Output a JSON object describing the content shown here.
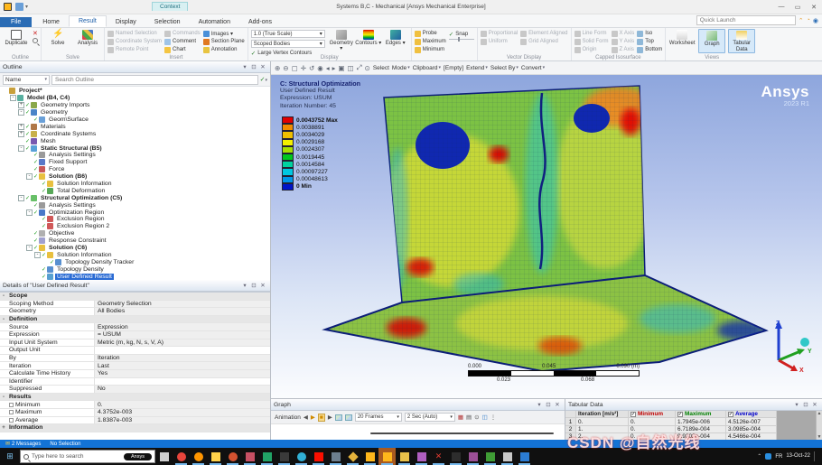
{
  "title_bar": {
    "title": "Systems B,C - Mechanical [Ansys Mechanical Enterprise]"
  },
  "icon_glyphs": {
    "dropdown": "▾",
    "undock": "⊡",
    "close": "✕",
    "minimize": "—",
    "restore": "▭",
    "expander_open": "-",
    "expander_closed": "+",
    "check": "✓"
  },
  "ribbon": {
    "context_label": "Context",
    "tabs": [
      "File",
      "Home",
      "Result",
      "Display",
      "Selection",
      "Automation",
      "Add-ons"
    ],
    "active_tab": "Result",
    "quick_launch_placeholder": "Quick Launch",
    "groups": {
      "outline": {
        "label": "Outline",
        "duplicate": "Duplicate"
      },
      "solve": {
        "label": "Solve",
        "solve": "Solve",
        "analysis": "Analysis"
      },
      "insert": {
        "label": "Insert",
        "cols": [
          [
            {
              "t": "Named Selection",
              "d": 1
            },
            {
              "t": "Coordinate System",
              "d": 1
            },
            {
              "t": "Remote Point",
              "d": 1
            }
          ],
          [
            {
              "t": "Commands",
              "d": 1
            },
            {
              "t": "Comment"
            },
            {
              "t": "Chart"
            }
          ],
          [
            {
              "t": "Images",
              "arrow": 1
            },
            {
              "t": "Section Plane"
            },
            {
              "t": "Annotation"
            }
          ]
        ]
      },
      "display": {
        "label": "Display",
        "scale": "1.0 (True Scale)",
        "bodies": "Scoped Bodies",
        "contours_check": "Large Vertex Contours",
        "big": [
          "Geometry",
          "Contours",
          "Edges"
        ]
      },
      "result_display": {
        "items": [
          "Probe",
          "Maximum",
          "Minimum"
        ],
        "snap": "Snap"
      },
      "vector": {
        "label": "Vector Display",
        "col1": [
          {
            "t": "Proportional",
            "d": 1
          },
          {
            "t": "Uniform",
            "d": 1
          }
        ],
        "col2": [
          {
            "t": "Element Aligned",
            "d": 1
          },
          {
            "t": "Grid Aligned",
            "d": 1
          }
        ]
      },
      "capped": {
        "label": "Capped Isosurface",
        "col1": [
          {
            "t": "Line Form",
            "d": 1
          },
          {
            "t": "Solid Form",
            "d": 1
          },
          {
            "t": "Origin",
            "d": 1
          }
        ],
        "col2": [
          {
            "t": "X Axis",
            "d": 1
          },
          {
            "t": "Y Axis",
            "d": 1
          },
          {
            "t": "Z Axis",
            "d": 1
          }
        ],
        "col3": [
          {
            "t": "Iso"
          },
          {
            "t": "Top"
          },
          {
            "t": "Bottom"
          }
        ]
      },
      "views": {
        "label": "Views",
        "items": [
          {
            "t": "Worksheet"
          },
          {
            "t": "Graph",
            "sel": 1
          },
          {
            "t": "Tabular Data",
            "sel": 1
          }
        ]
      }
    }
  },
  "graphics_toolbar": {
    "icons": [
      "zoom-in-icon",
      "zoom-out-icon",
      "box-zoom-icon",
      "pan-icon",
      "rotate-icon",
      "look-at-icon",
      "previous-view-icon",
      "next-view-icon",
      "fit-icon",
      "wireframe-icon",
      "zoom-fit-icon",
      "magnifier-icon"
    ],
    "buttons": [
      {
        "label": "Select",
        "arrow": 0
      },
      {
        "label": "Mode",
        "arrow": 1
      },
      {
        "label": "Clipboard",
        "arrow": 1
      },
      {
        "label": "[Empty]",
        "arrow": 0
      },
      {
        "label": "Extend",
        "arrow": 1
      },
      {
        "label": "Select By",
        "arrow": 1
      },
      {
        "label": "Convert",
        "arrow": 1
      }
    ]
  },
  "outline": {
    "header": "Outline",
    "filter_label": "Name",
    "search_placeholder": "Search Outline",
    "tree": [
      {
        "l": 0,
        "label": "Project*",
        "icon": "project",
        "bold": 1
      },
      {
        "l": 1,
        "label": "Model (B4, C4)",
        "icon": "model",
        "bold": 1,
        "exp": "-"
      },
      {
        "l": 2,
        "label": "Geometry Imports",
        "icon": "geometry-imports",
        "exp": "+",
        "ck": 1
      },
      {
        "l": 2,
        "label": "Geometry",
        "icon": "geometry",
        "exp": "-",
        "ck": 1
      },
      {
        "l": 3,
        "label": "Geom\\Surface",
        "icon": "surface",
        "ck": 1
      },
      {
        "l": 2,
        "label": "Materials",
        "icon": "materials",
        "exp": "+",
        "ck": 1
      },
      {
        "l": 2,
        "label": "Coordinate Systems",
        "icon": "coordinate-systems",
        "exp": "+",
        "ck": 1
      },
      {
        "l": 2,
        "label": "Mesh",
        "icon": "mesh",
        "ck": 1
      },
      {
        "l": 2,
        "label": "Static Structural (B5)",
        "icon": "static-structural",
        "bold": 1,
        "exp": "-",
        "ck": 1
      },
      {
        "l": 3,
        "label": "Analysis Settings",
        "icon": "analysis-settings",
        "ck": 1
      },
      {
        "l": 3,
        "label": "Fixed Support",
        "icon": "fixed-support",
        "ck": 1
      },
      {
        "l": 3,
        "label": "Force",
        "icon": "force",
        "ck": 1
      },
      {
        "l": 3,
        "label": "Solution (B6)",
        "icon": "solution",
        "bold": 1,
        "exp": "-",
        "ck": 1
      },
      {
        "l": 4,
        "label": "Solution Information",
        "icon": "solution-information",
        "ck": 1
      },
      {
        "l": 4,
        "label": "Total Deformation",
        "icon": "result",
        "ck": 1
      },
      {
        "l": 2,
        "label": "Structural Optimization (C5)",
        "icon": "structural-optimization",
        "bold": 1,
        "exp": "-",
        "ck": 1
      },
      {
        "l": 3,
        "label": "Analysis Settings",
        "icon": "analysis-settings",
        "ck": 1
      },
      {
        "l": 3,
        "label": "Optimization Region",
        "icon": "optimization-region",
        "exp": "-",
        "ck": 1
      },
      {
        "l": 4,
        "label": "Exclusion Region",
        "icon": "exclusion-region",
        "ck": 1
      },
      {
        "l": 4,
        "label": "Exclusion Region 2",
        "icon": "exclusion-region",
        "ck": 1
      },
      {
        "l": 3,
        "label": "Objective",
        "icon": "objective",
        "ck": 1
      },
      {
        "l": 3,
        "label": "Response Constraint",
        "icon": "response-constraint",
        "ck": 1
      },
      {
        "l": 3,
        "label": "Solution (C6)",
        "icon": "solution",
        "bold": 1,
        "exp": "-",
        "ck": 1
      },
      {
        "l": 4,
        "label": "Solution Information",
        "icon": "solution-information",
        "exp": "-",
        "ck": 1
      },
      {
        "l": 5,
        "label": "Topology Density Tracker",
        "icon": "tracker",
        "ck": 1
      },
      {
        "l": 4,
        "label": "Topology Density",
        "icon": "topology-density",
        "ck": 1
      },
      {
        "l": 4,
        "label": "User Defined Result",
        "icon": "user-defined-result",
        "sel": 1,
        "ck": 1
      }
    ]
  },
  "details": {
    "header": "Details of \"User Defined Result\"",
    "sections": [
      {
        "name": "Scope",
        "exp": "-",
        "rows": [
          {
            "k": "Scoping Method",
            "v": "Geometry Selection"
          },
          {
            "k": "Geometry",
            "v": "All Bodies"
          }
        ]
      },
      {
        "name": "Definition",
        "exp": "-",
        "rows": [
          {
            "k": "Source",
            "v": "Expression"
          },
          {
            "k": "Expression",
            "v": "= USUM"
          },
          {
            "k": "Input Unit System",
            "v": "Metric (m, kg, N, s, V, A)"
          },
          {
            "k": "Output Unit",
            "v": ""
          },
          {
            "k": "By",
            "v": "Iteration"
          },
          {
            "k": "Iteration",
            "v": "Last"
          },
          {
            "k": "Calculate Time History",
            "v": "Yes"
          },
          {
            "k": "Identifier",
            "v": ""
          },
          {
            "k": "Suppressed",
            "v": "No"
          }
        ]
      },
      {
        "name": "Results",
        "exp": "-",
        "rows": [
          {
            "k": "Minimum",
            "v": "0.",
            "cb": 1
          },
          {
            "k": "Maximum",
            "v": "4.3752e-003",
            "cb": 1
          },
          {
            "k": "Average",
            "v": "1.8387e-003",
            "cb": 1
          }
        ]
      },
      {
        "name": "Information",
        "exp": "+",
        "rows": []
      }
    ]
  },
  "viewport": {
    "annotation": {
      "line1": "C: Structural Optimization",
      "line2": "User Defined Result",
      "line3": "Expression: USUM",
      "line4": "Iteration Number: 45"
    },
    "legend": {
      "values": [
        "0.0043752 Max",
        "0.0038891",
        "0.0034029",
        "0.0029168",
        "0.0024307",
        "0.0019445",
        "0.0014584",
        "0.00097227",
        "0.00048613",
        "0 Min"
      ],
      "colors": [
        "#e00000",
        "#f08c00",
        "#f0c000",
        "#f4f000",
        "#a8e000",
        "#00c81e",
        "#00d2a0",
        "#00c8e0",
        "#0096e8",
        "#0014c8"
      ]
    },
    "logo": {
      "name": "Ansys",
      "version": "2023 R1"
    },
    "ruler": {
      "t0": "0.000",
      "t1": "0.045",
      "t2": "0.090 (m)",
      "b0": "0.023",
      "b1": "0.068"
    },
    "triad": {
      "x": "X",
      "y": "Y",
      "z": "Z",
      "x_color": "#d02020",
      "y_color": "#20a020",
      "z_color": "#2040d0"
    }
  },
  "graph": {
    "header": "Graph",
    "animation_label": "Animation",
    "frames": "20 Frames",
    "duration": "2 Sec (Auto)"
  },
  "tabular": {
    "header": "Tabular Data",
    "columns": {
      "iteration": "Iteration [m/s²]",
      "min": "Minimum",
      "max": "Maximum",
      "avg": "Average"
    },
    "rows": [
      {
        "n": "1",
        "iter": "0.",
        "min": "0.",
        "max": "1.7945e-006",
        "avg": "4.5126e-007"
      },
      {
        "n": "2",
        "iter": "1.",
        "min": "0.",
        "max": "6.7189e-004",
        "avg": "3.0985e-004"
      },
      {
        "n": "3",
        "iter": "2.",
        "min": "0.",
        "max": "9.9202e-004",
        "avg": "4.5466e-004"
      }
    ]
  },
  "status_bar": {
    "messages": "2 Messages",
    "selection": "No Selection"
  },
  "watermark": {
    "text": "CSDN @自然光线"
  },
  "taskbar": {
    "search_placeholder": "Type here to search",
    "search_button": "Ansys",
    "icons": [
      {
        "name": "task-view-icon",
        "color": "#cfcfcf",
        "shape": "square",
        "run": 0
      },
      {
        "name": "chrome-icon",
        "color": "#e8453c",
        "shape": "circle",
        "run": 1
      },
      {
        "name": "firefox-icon",
        "color": "#ff9500",
        "shape": "circle",
        "run": 1
      },
      {
        "name": "file-explorer-icon",
        "color": "#ffd24a",
        "shape": "square",
        "run": 1
      },
      {
        "name": "powerpoint-icon",
        "color": "#d35230",
        "shape": "circle",
        "run": 1
      },
      {
        "name": "photos-icon",
        "color": "#c75064",
        "shape": "square",
        "run": 1
      },
      {
        "name": "excel-icon",
        "color": "#21a366",
        "shape": "square",
        "run": 1
      },
      {
        "name": "terminal-icon",
        "color": "#3a3a3a",
        "shape": "square",
        "run": 1
      },
      {
        "name": "designer-icon",
        "color": "#31b0d5",
        "shape": "circle",
        "run": 1
      },
      {
        "name": "acrobat-icon",
        "color": "#fa0f00",
        "shape": "square",
        "run": 1
      },
      {
        "name": "chat-icon",
        "color": "#6d7f8f",
        "shape": "square",
        "run": 1
      },
      {
        "name": "diamond-app-icon",
        "color": "#e4b33c",
        "shape": "diamond",
        "run": 1
      },
      {
        "name": "ansys-launcher-icon",
        "color": "#ffb71b",
        "shape": "square",
        "run": 1
      },
      {
        "name": "ansys-mechanical-icon",
        "color": "#ffb71b",
        "shape": "square",
        "run": 1,
        "active": 1
      },
      {
        "name": "license-key-icon",
        "color": "#e8c14a",
        "shape": "square",
        "run": 1
      },
      {
        "name": "puzzle-app-icon",
        "color": "#b05fc0",
        "shape": "square",
        "run": 1
      },
      {
        "name": "red-x-app-icon",
        "color": "#e03c31",
        "shape": "x",
        "run": 1
      },
      {
        "name": "console-app-icon",
        "color": "#2d2d2d",
        "shape": "square",
        "run": 1
      },
      {
        "name": "visual-studio-icon",
        "color": "#9b4f96",
        "shape": "square",
        "run": 1
      },
      {
        "name": "green-app-icon",
        "color": "#3f9c35",
        "shape": "square",
        "run": 1
      },
      {
        "name": "grid-app-icon",
        "color": "#c8c8c8",
        "shape": "square",
        "run": 1
      },
      {
        "name": "mail-app-icon",
        "color": "#2b7cd3",
        "shape": "square",
        "run": 1
      }
    ],
    "tray": {
      "lang": "FR",
      "date": "13-Oct-22"
    }
  }
}
